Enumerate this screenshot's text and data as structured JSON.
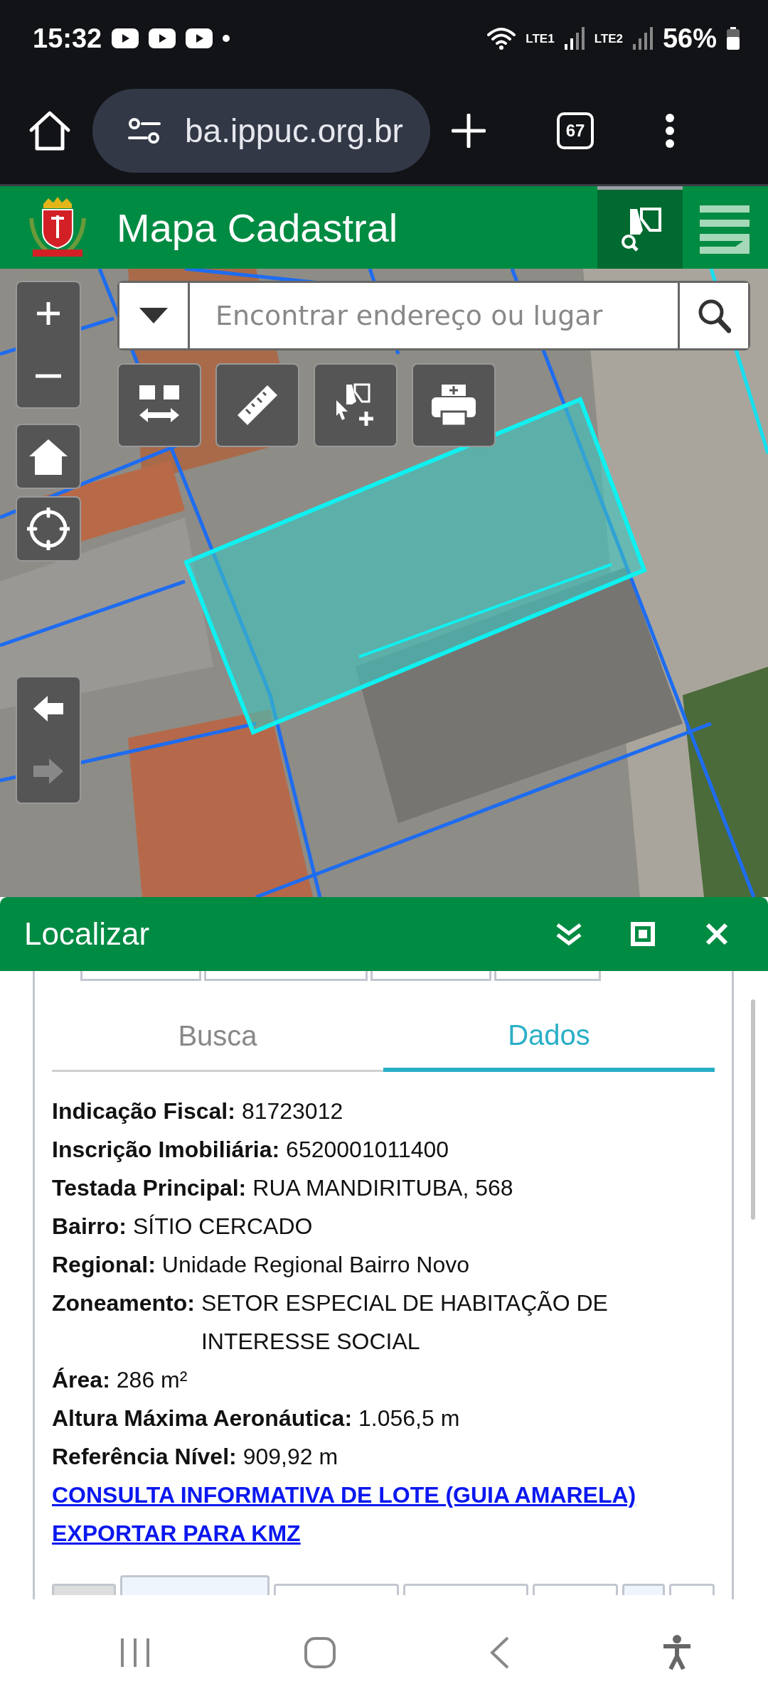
{
  "status_bar": {
    "time": "15:32",
    "sim_1": "LTE1",
    "sim_2": "LTE2",
    "battery": "56%"
  },
  "browser": {
    "url": "ba.ippuc.org.br",
    "tab_count": "67"
  },
  "header": {
    "title": "Mapa Cadastral"
  },
  "map": {
    "search": {
      "placeholder": "Encontrar endereço ou lugar"
    },
    "history": [
      {
        "kind": "back",
        "disabled": false
      },
      {
        "kind": "forward",
        "disabled": true
      }
    ]
  },
  "panel": {
    "title": "Localizar",
    "tabs": [
      {
        "label": "Busca",
        "selected": false
      },
      {
        "label": "Dados",
        "selected": true
      }
    ],
    "fields": [
      {
        "label": "Indicação Fiscal:",
        "value": "81723012"
      },
      {
        "label": "Inscrição Imobiliária:",
        "value": "6520001011400"
      },
      {
        "label": "Testada Principal:",
        "value": "RUA MANDIRITUBA, 568"
      },
      {
        "label": "Bairro:",
        "value": "SÍTIO CERCADO"
      },
      {
        "label": "Regional:",
        "value": "Unidade Regional Bairro Novo"
      },
      {
        "label": "Zoneamento:",
        "value": "SETOR ESPECIAL DE HABITAÇÃO DE INTERESSE SOCIAL"
      },
      {
        "label": "Área:",
        "value": "286 m²"
      },
      {
        "label": "Altura Máxima Aeronáutica:",
        "value": "1.056,5 m"
      },
      {
        "label": "Referência Nível:",
        "value": "909,92 m"
      }
    ],
    "links": [
      "CONSULTA INFORMATIVA DE LOTE (GUIA AMARELA)",
      "EXPORTAR PARA KMZ"
    ]
  }
}
